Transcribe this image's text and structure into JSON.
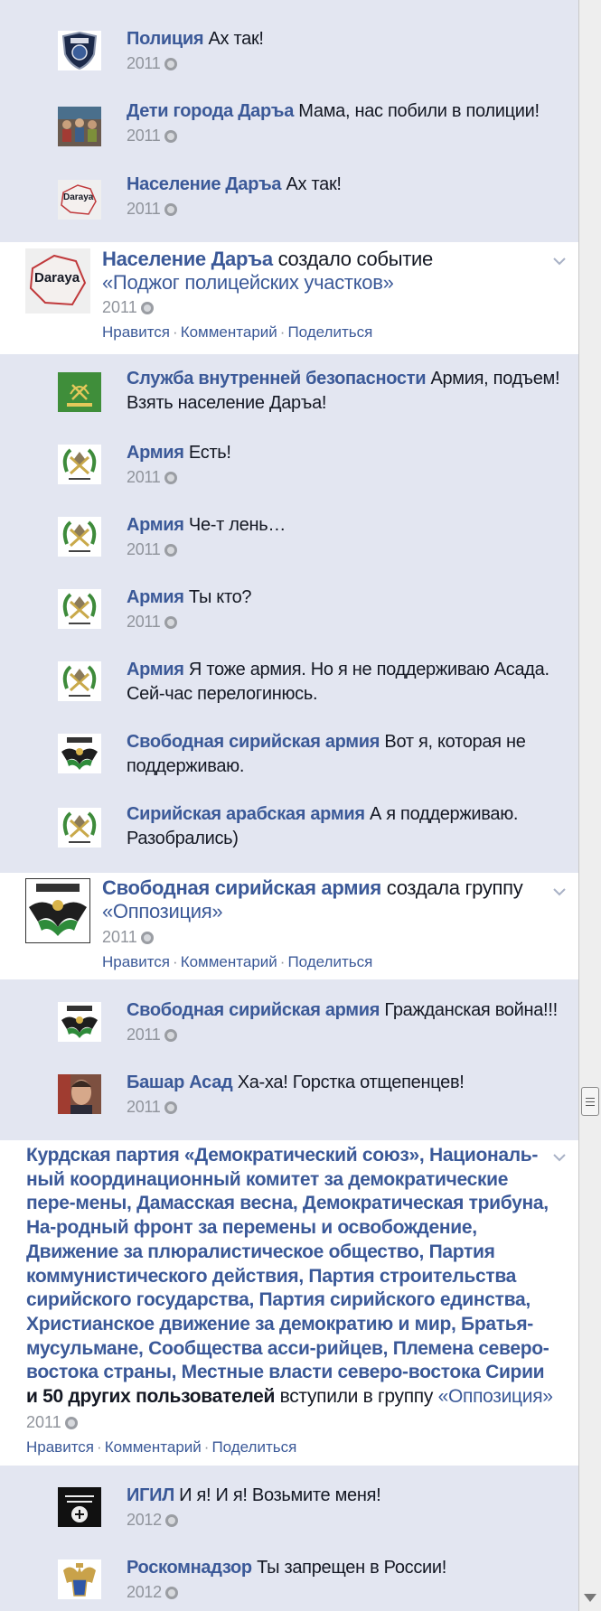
{
  "comments_group_1": [
    {
      "author": "Полиция",
      "text": " Ах так!",
      "year": "2011",
      "avatar": "police-badge"
    },
    {
      "author": "Дети города Даръа",
      "text": " Мама, нас побили в полиции!",
      "year": "2011",
      "avatar": "children-photo"
    },
    {
      "author": "Население Даръа",
      "text": " Ах так!",
      "year": "2011",
      "avatar": "daraya-map",
      "avatar_text": "Daraya"
    }
  ],
  "post_1": {
    "author": "Население Даръа",
    "action": " создало событие",
    "object": "«Поджог полицейских участков»",
    "year": "2011",
    "avatar_text": "Daraya",
    "actions": [
      "Нравится",
      "Комментарий",
      "Поделиться"
    ]
  },
  "comments_group_2": [
    {
      "author": "Служба внутренней безопасности",
      "text": " Армия, подъем! Взять население Даръа!",
      "year": "",
      "avatar": "security-emblem"
    },
    {
      "author": "Армия",
      "text": " Есть!",
      "year": "2011",
      "avatar": "army-emblem"
    },
    {
      "author": "Армия",
      "text": " Че-т лень…",
      "year": "2011",
      "avatar": "army-emblem"
    },
    {
      "author": "Армия",
      "text": " Ты кто?",
      "year": "2011",
      "avatar": "army-emblem"
    },
    {
      "author": "Армия",
      "text": " Я тоже армия. Но я не поддерживаю Асада. Сей-час перелогинюсь.",
      "year": "",
      "avatar": "army-emblem"
    },
    {
      "author": "Свободная сирийская армия",
      "text": " Вот я, которая не поддерживаю.",
      "year": "",
      "avatar": "fsa-emblem"
    },
    {
      "author": "Сирийская арабская армия",
      "text": " А я поддерживаю. Разобрались)",
      "year": "",
      "avatar": "army-emblem"
    }
  ],
  "post_2": {
    "author": "Свободная сирийская армия",
    "action": " создала группу",
    "object": "«Оппозиция»",
    "year": "2011",
    "actions": [
      "Нравится",
      "Комментарий",
      "Поделиться"
    ]
  },
  "comments_group_3": [
    {
      "author": "Свободная сирийская армия",
      "text": " Гражданская война!!!",
      "year": "2011",
      "avatar": "fsa-emblem"
    },
    {
      "author": "Башар Асад",
      "text": " Ха-ха! Горстка отщепенцев!",
      "year": "2011",
      "avatar": "assad-photo"
    }
  ],
  "post_3": {
    "members": "Курдская партия «Демократический союз», Националь-ный координационный комитет за демократические пере-мены, Дамасская весна, Демократическая трибуна, На-родный фронт за перемены и освобождение, Движение за плюралистическое общество, Партия коммунистического действия, Партия строительства сирийского государства, Партия сирийского единства, Христианское движение за демократию и мир, Братья-мусульмане, Сообщества асси-рийцев, Племена северо-востока страны, Местные власти северо-востока Сирии",
    "and_more": " и 50 других пользователей",
    "action": " вступили в группу ",
    "object": "«Оппозиция»",
    "year": "2011",
    "actions": [
      "Нравится",
      "Комментарий",
      "Поделиться"
    ]
  },
  "comments_group_4": [
    {
      "author": "ИГИЛ",
      "text": " И я! И я! Возьмите меня!",
      "year": "2012",
      "avatar": "isis-flag"
    },
    {
      "author": "Роскомнадзор",
      "text": " Ты запрещен в России!",
      "year": "2012",
      "avatar": "russia-emblem"
    }
  ],
  "colors": {
    "link": "#3b5998",
    "meta": "#90949c",
    "feed_bg": "#e3e6f1",
    "post_bg": "#ffffff"
  }
}
